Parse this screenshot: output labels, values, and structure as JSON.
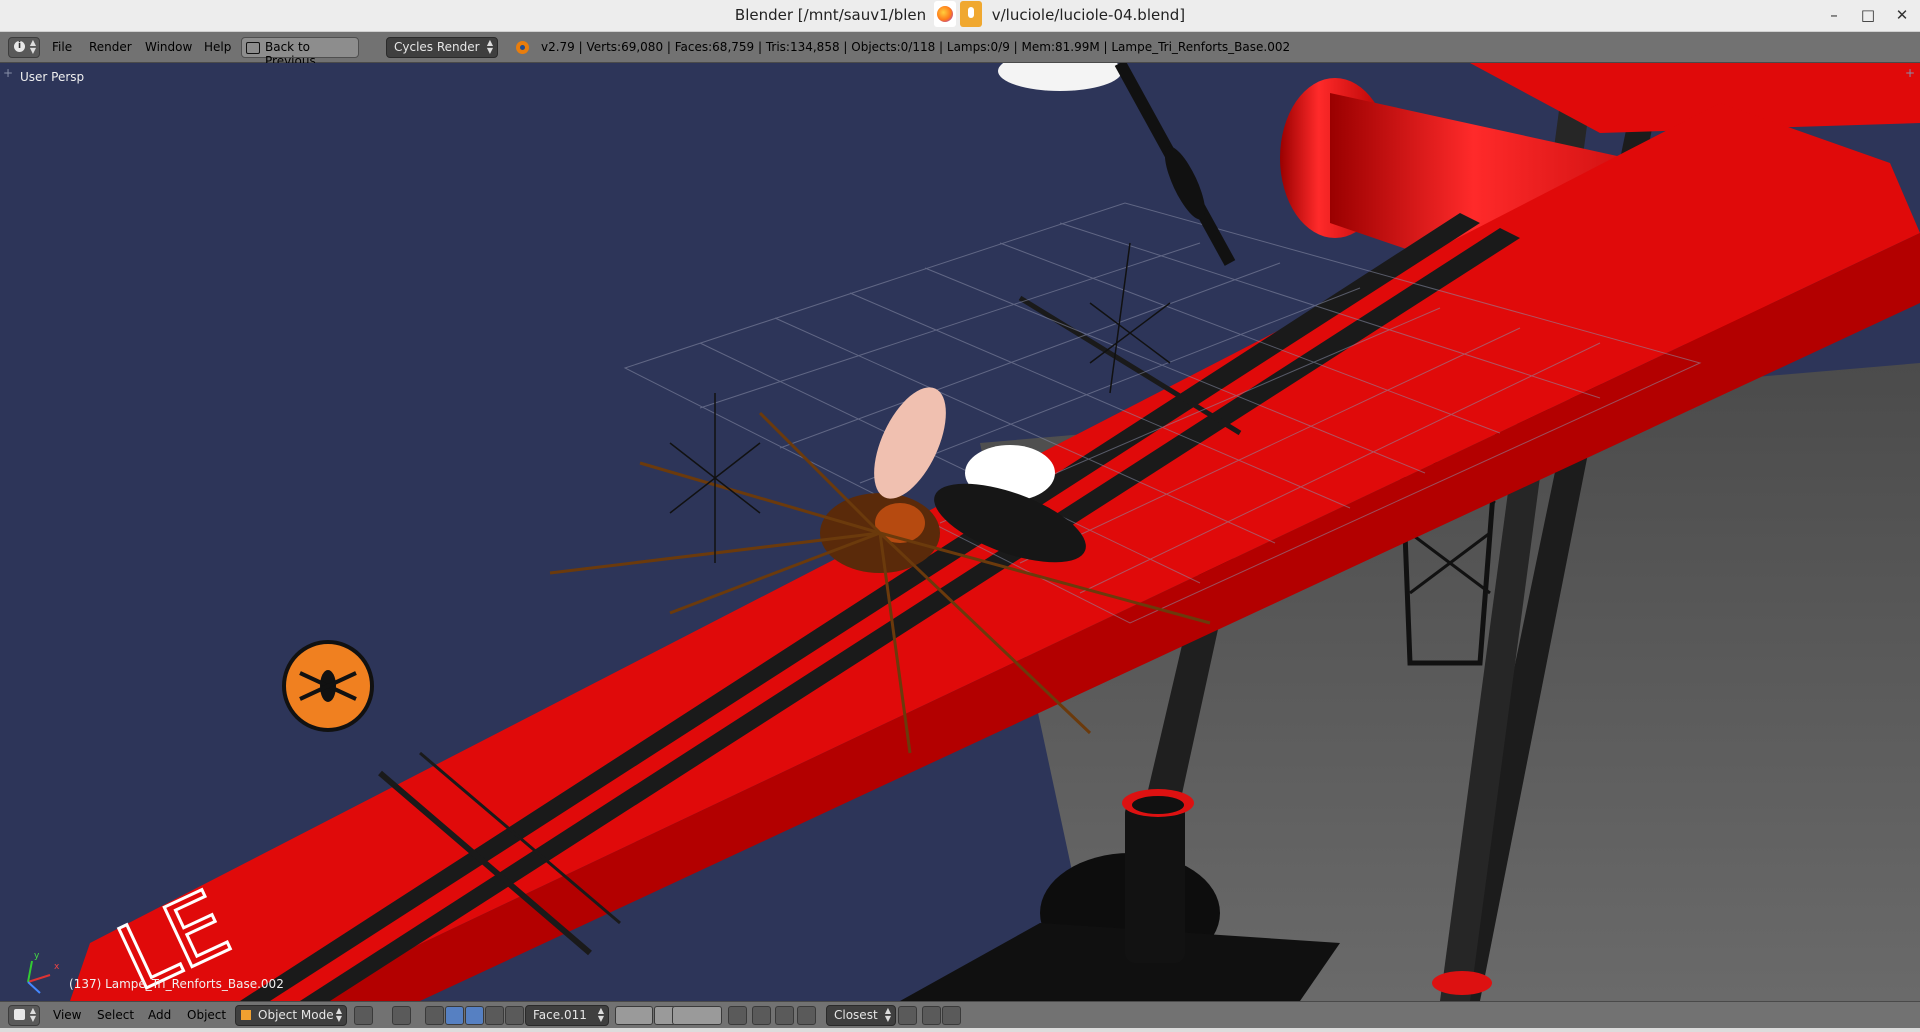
{
  "window": {
    "title": "Blender [/mnt/sauv1/blen",
    "title_tail": "v/luciole/luciole-04.blend]",
    "controls": {
      "minimize": "–",
      "maximize": "□",
      "close": "✕"
    }
  },
  "header": {
    "editor_type_icon": "info-icon",
    "menu": [
      "File",
      "Render",
      "Window",
      "Help"
    ],
    "back_button": "Back to Previous",
    "render_engine": "Cycles Render",
    "stats": "v2.79 | Verts:69,080 | Faces:68,759 | Tris:134,858 | Objects:0/118 | Lamps:0/9 | Mem:81.99M | Lampe_Tri_Renforts_Base.002"
  },
  "viewport": {
    "view_label": "User Persp",
    "object_label": "(137) Lampe_Tri_Renforts_Base.002",
    "plus_glyph": "+",
    "axis_x": "x",
    "axis_y": "y",
    "colors": {
      "background": "#2d3559",
      "beam": "#e00a0a",
      "stripe": "#1a1a1a",
      "floor": "#5a5a5a",
      "badge": "#f08020"
    }
  },
  "footer": {
    "menu": [
      "View",
      "Select",
      "Add",
      "Object"
    ],
    "mode": "Object Mode",
    "transform_orientation": "Face.011",
    "snap_target": "Closest"
  }
}
